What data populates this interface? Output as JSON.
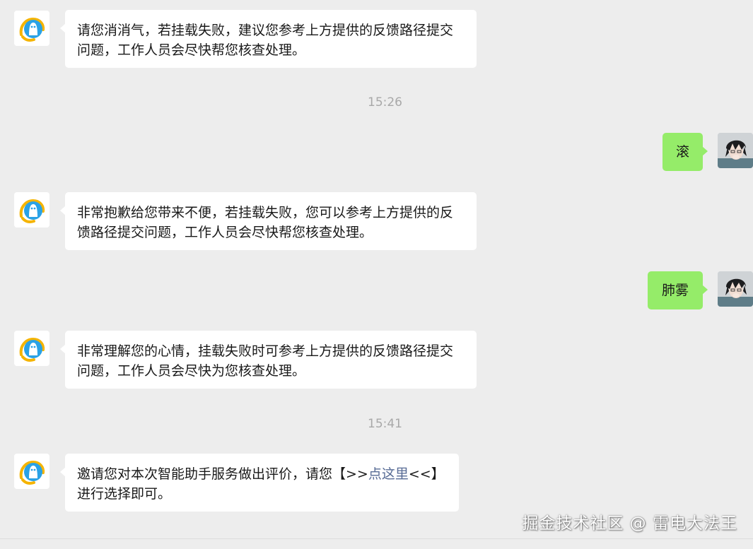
{
  "messages": [
    {
      "sender": "bot",
      "text": "请您消消气，若挂载失败，建议您参考上方提供的反馈路径提交问题，工作人员会尽快帮您核查处理。"
    },
    {
      "time": "15:26"
    },
    {
      "sender": "user",
      "text": "滚"
    },
    {
      "sender": "bot",
      "text": "非常抱歉给您带来不便，若挂载失败，您可以参考上方提供的反馈路径提交问题，工作人员会尽快帮您核查处理。"
    },
    {
      "sender": "user",
      "text": "肺雾"
    },
    {
      "sender": "bot",
      "text": "非常理解您的心情，挂载失败时可参考上方提供的反馈路径提交问题，工作人员会尽快为您核查处理。"
    },
    {
      "time": "15:41"
    },
    {
      "sender": "bot",
      "text_before": "邀请您对本次智能助手服务做出评价，请您【>>",
      "link": "点这里",
      "text_after": "<<】进行选择即可。"
    }
  ],
  "watermark": "掘金技术社区 @ 雷电大法王",
  "colors": {
    "background": "#ededed",
    "bot_bubble": "#ffffff",
    "user_bubble": "#95ec69",
    "link": "#576b95",
    "timestamp": "#a8a8a8"
  },
  "icons": {
    "bot_avatar": "qq-penguin-assistant-icon",
    "user_avatar": "anime-character-avatar"
  }
}
